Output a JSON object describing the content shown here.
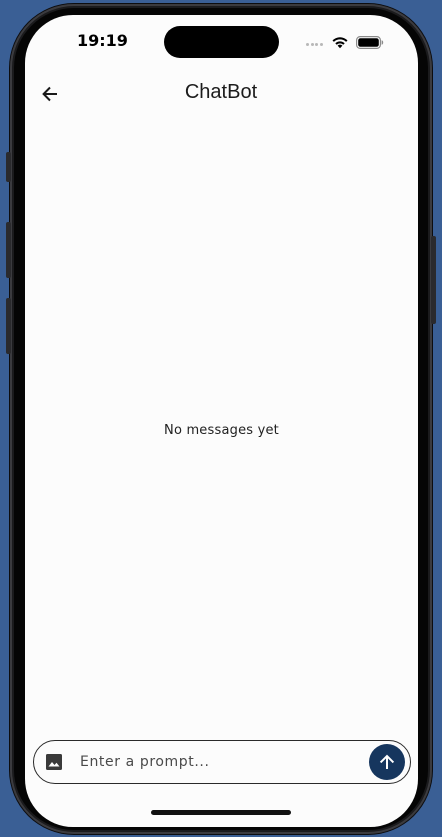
{
  "colors": {
    "backdrop": "#3a5f95",
    "screen_background": "#fcfcfc",
    "send_button": "#16365e",
    "text": "#1c1c1c"
  },
  "status_bar": {
    "time": "19:19",
    "icons": [
      "signal-dots-icon",
      "wifi-icon",
      "battery-icon"
    ]
  },
  "app_bar": {
    "back_icon": "arrow-left-icon",
    "title": "ChatBot"
  },
  "messages": {
    "empty_text": "No messages yet"
  },
  "composer": {
    "image_icon": "image-icon",
    "placeholder": "Enter a prompt...",
    "value": "",
    "send_icon": "arrow-up-icon"
  }
}
